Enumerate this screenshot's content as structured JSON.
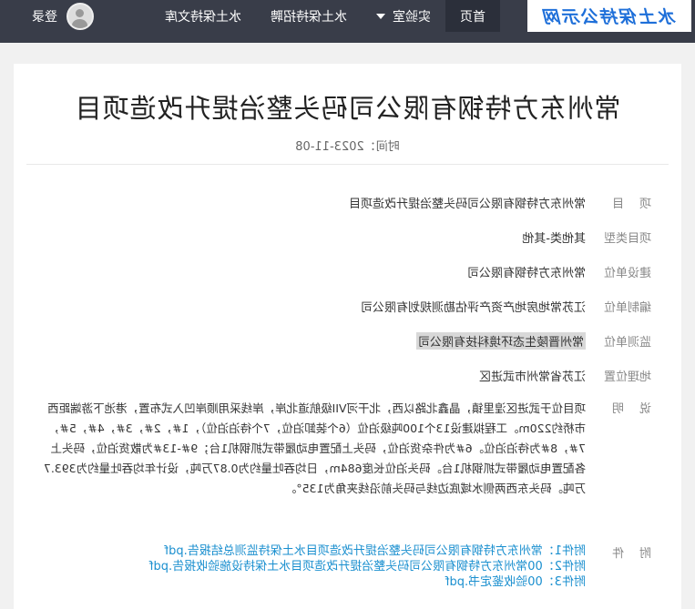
{
  "site": {
    "brand": "水土保持公示网"
  },
  "nav": {
    "home": "首页",
    "lab": "实验室",
    "recruit": "水土保持招聘",
    "library": "水土保持文库",
    "login": "登录"
  },
  "article": {
    "title": "常州东方特钢有限公司码头整治提升改造项目",
    "date_label": "时间：2023-11-08"
  },
  "fields": [
    {
      "label": "项　目",
      "value": "常州东方特钢有限公司码头整治提升改造项目"
    },
    {
      "label": "项目类型",
      "value": "其他类-其他"
    },
    {
      "label": "建设单位",
      "value": "常州东方特钢有限公司"
    },
    {
      "label": "编制单位",
      "value": "江苏常地房地产资产评估勘测规划有限公司"
    },
    {
      "label": "监测单位",
      "value": "常州晋陵生态环境科技有限公司"
    },
    {
      "label": "地理位置",
      "value": "江苏省常州市武进区"
    }
  ],
  "description": {
    "label": "说　明",
    "text": "项目位于武进区湟里镇，晶鑫北路以西，北干河VII级航道北岸，岸线采用顺岸凹入式布置，港池下游端距西市桥约220m。工程拟建设13个100吨级泊位（6个装卸泊位，7个待泊泊位），1#，2#，3#，4#，5#，7#，8#为待泊泊位。6#为件杂货泊位，码头上配置电动履带式抓钢机1台；9#-13#为散货泊位，码头上各配置电动履带式抓钢机1台。码头泊位长度684m，日均吞吐量约为0.87万吨，设计年均吞吐量约为393.7万吨。码头东西两侧水域底边线与码头前沿线夹角为135°。"
  },
  "attachments": {
    "label": "附　件",
    "items": [
      "附件1：常州东方特钢有限公司码头整治提升改造项目水土保持监测总结报告.pdf",
      "附件2：00常州东方特钢有限公司码头整治提升改造项目水土保持设施验收报告.pdf",
      "附件3：00验收鉴定书.pdf"
    ]
  }
}
